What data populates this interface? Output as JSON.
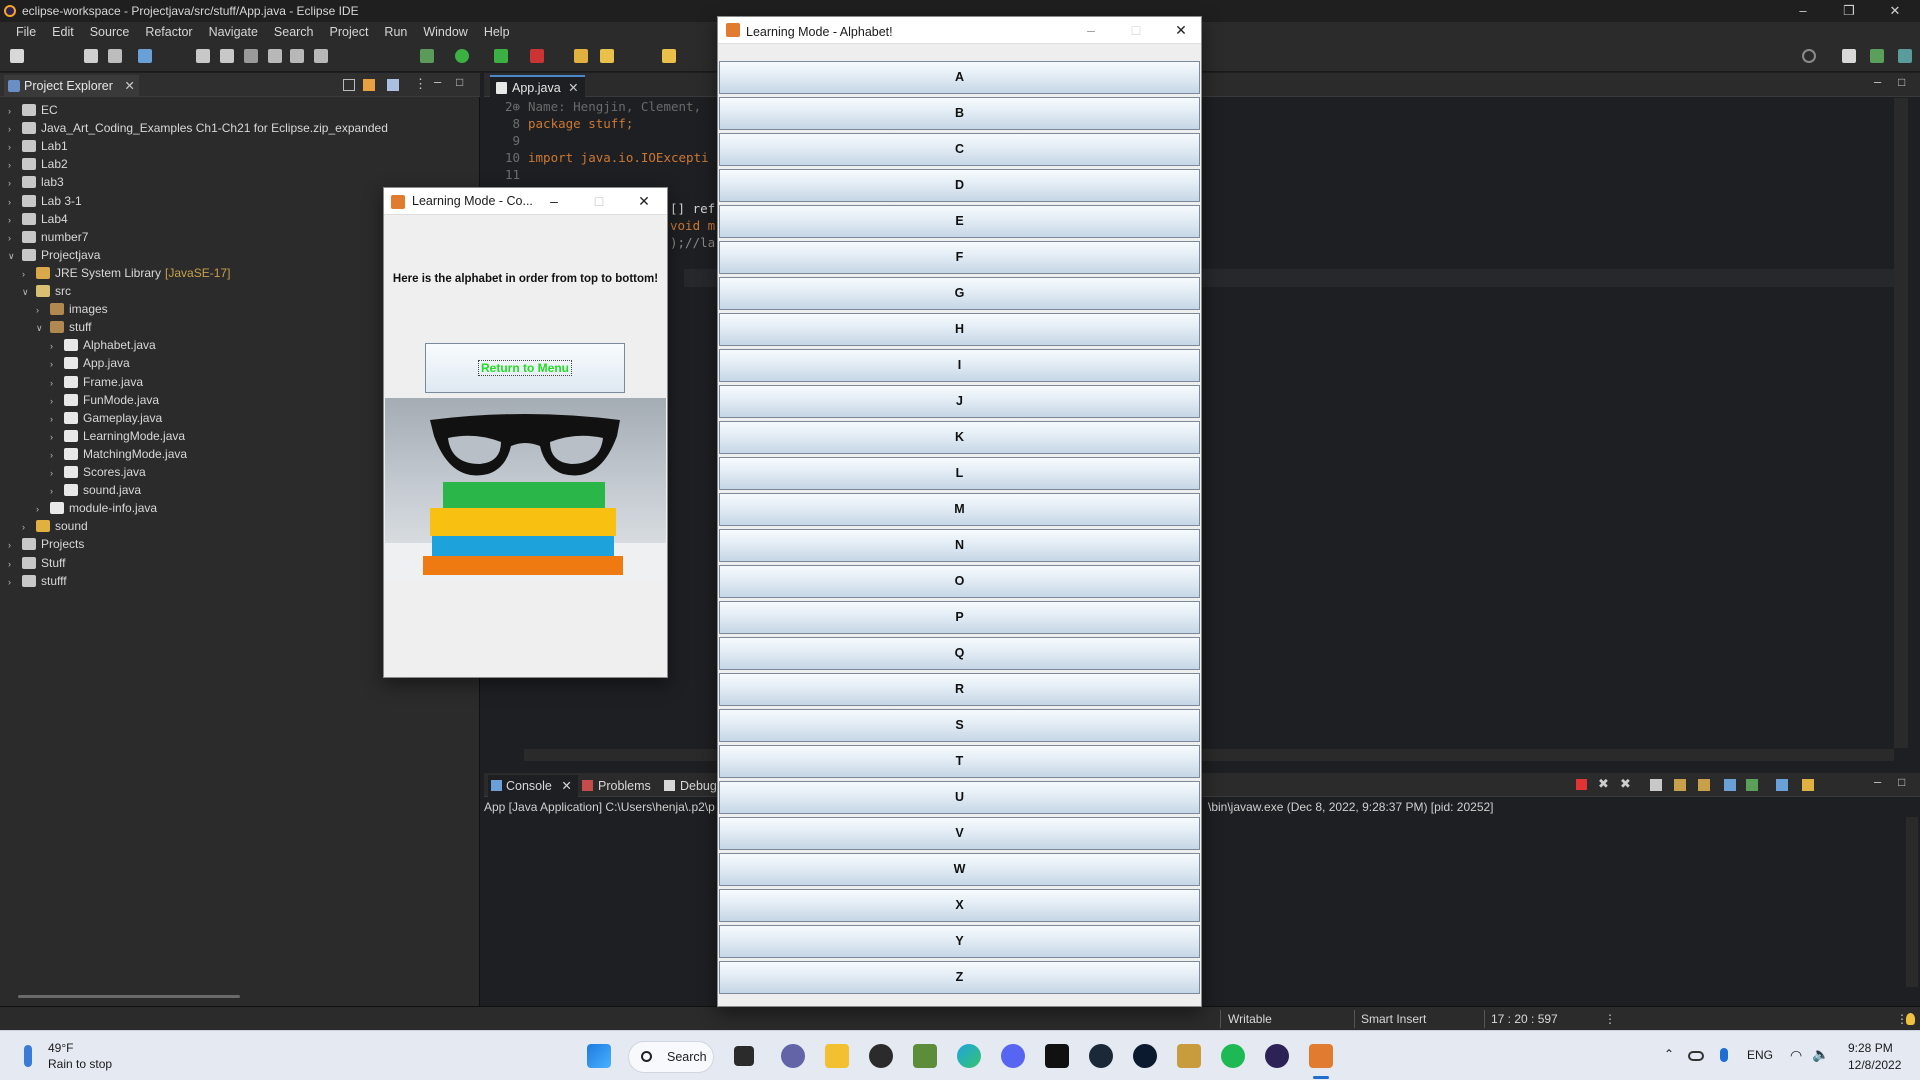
{
  "ide": {
    "window_title": "eclipse-workspace - Projectjava/src/stuff/App.java - Eclipse IDE",
    "menu": [
      "File",
      "Edit",
      "Source",
      "Refactor",
      "Navigate",
      "Search",
      "Project",
      "Run",
      "Window",
      "Help"
    ]
  },
  "explorer": {
    "tab_label": "Project Explorer",
    "items": [
      {
        "label": "EC",
        "depth": 0,
        "kind": "project"
      },
      {
        "label": "Java_Art_Coding_Examples Ch1-Ch21 for Eclipse.zip_expanded",
        "depth": 0,
        "kind": "project"
      },
      {
        "label": "Lab1",
        "depth": 0,
        "kind": "project"
      },
      {
        "label": "Lab2",
        "depth": 0,
        "kind": "project"
      },
      {
        "label": "lab3",
        "depth": 0,
        "kind": "project"
      },
      {
        "label": "Lab 3-1",
        "depth": 0,
        "kind": "project"
      },
      {
        "label": "Lab4",
        "depth": 0,
        "kind": "project"
      },
      {
        "label": "number7",
        "depth": 0,
        "kind": "project"
      },
      {
        "label": "Projectjava",
        "depth": 0,
        "kind": "project-open"
      },
      {
        "label": "JRE System Library",
        "decoration": "[JavaSE-17]",
        "depth": 1,
        "kind": "library"
      },
      {
        "label": "src",
        "depth": 1,
        "kind": "src-open"
      },
      {
        "label": "images",
        "depth": 2,
        "kind": "package"
      },
      {
        "label": "stuff",
        "depth": 2,
        "kind": "package-open"
      },
      {
        "label": "Alphabet.java",
        "depth": 3,
        "kind": "java"
      },
      {
        "label": "App.java",
        "depth": 3,
        "kind": "java"
      },
      {
        "label": "Frame.java",
        "depth": 3,
        "kind": "java"
      },
      {
        "label": "FunMode.java",
        "depth": 3,
        "kind": "java"
      },
      {
        "label": "Gameplay.java",
        "depth": 3,
        "kind": "java"
      },
      {
        "label": "LearningMode.java",
        "depth": 3,
        "kind": "java"
      },
      {
        "label": "MatchingMode.java",
        "depth": 3,
        "kind": "java"
      },
      {
        "label": "Scores.java",
        "depth": 3,
        "kind": "java"
      },
      {
        "label": "sound.java",
        "depth": 3,
        "kind": "java"
      },
      {
        "label": "module-info.java",
        "depth": 2,
        "kind": "java"
      },
      {
        "label": "sound",
        "depth": 1,
        "kind": "folder"
      },
      {
        "label": "Projects",
        "depth": 0,
        "kind": "project"
      },
      {
        "label": "Stuff",
        "depth": 0,
        "kind": "project"
      },
      {
        "label": "stufff",
        "depth": 0,
        "kind": "project"
      }
    ]
  },
  "editor": {
    "tab_label": "App.java",
    "lines": [
      {
        "num": "2⊕",
        "text": "Name: Hengjin, Clement,",
        "style": "cm"
      },
      {
        "num": "8",
        "text": "package stuff;",
        "style": "pkg"
      },
      {
        "num": "9",
        "text": "",
        "style": "pl"
      },
      {
        "num": "10",
        "text": "import java.io.IOExcepti",
        "style": "imp"
      },
      {
        "num": "11",
        "text": "",
        "style": "pl"
      }
    ],
    "fragments": [
      "[] ref",
      "void m",
      ");//la"
    ]
  },
  "console": {
    "tabs": [
      "Console",
      "Problems",
      "Debug"
    ],
    "launch_left": "App [Java Application] C:\\Users\\henja\\.p2\\p",
    "launch_right": "\\bin\\javaw.exe  (Dec 8, 2022, 9:28:37 PM) [pid: 20252]"
  },
  "status": {
    "writable": "Writable",
    "insert_mode": "Smart Insert",
    "position": "17 : 20 : 597"
  },
  "taskbar": {
    "weather_temp": "49°F",
    "weather_desc": "Rain to stop",
    "search_label": "Search",
    "lang": "ENG",
    "time": "9:28 PM",
    "date": "12/8/2022"
  },
  "small_window": {
    "title": "Learning Mode - Co...",
    "message": "Here is the alphabet in order from top to bottom!",
    "return_button": "Return to Menu"
  },
  "big_window": {
    "title": "Learning Mode - Alphabet!",
    "letters": [
      "A",
      "B",
      "C",
      "D",
      "E",
      "F",
      "G",
      "H",
      "I",
      "J",
      "K",
      "L",
      "M",
      "N",
      "O",
      "P",
      "Q",
      "R",
      "S",
      "T",
      "U",
      "V",
      "W",
      "X",
      "Y",
      "Z"
    ]
  },
  "colors": {
    "ide_bg": "#1e1f22",
    "panel_bg": "#2b2b2b",
    "keyword": "#cc7832",
    "return_text": "#22dd22",
    "taskbar_bg": "#e4e9f2"
  }
}
